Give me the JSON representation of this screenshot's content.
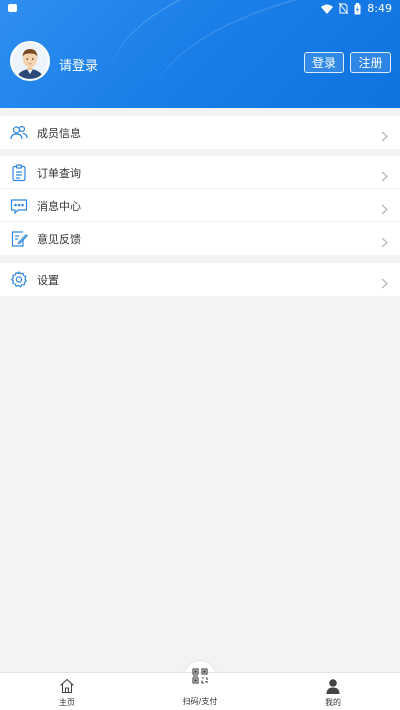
{
  "status_bar": {
    "time": "8:49",
    "icons": [
      "notification-icon",
      "wifi-icon",
      "no-sim-icon",
      "battery-icon"
    ]
  },
  "header": {
    "login_prompt": "请登录",
    "login_button": "登录",
    "register_button": "注册"
  },
  "menu": {
    "group1": [
      {
        "label": "成员信息",
        "icon": "members-icon"
      }
    ],
    "group2": [
      {
        "label": "订单查询",
        "icon": "order-icon"
      },
      {
        "label": "消息中心",
        "icon": "message-icon"
      },
      {
        "label": "意见反馈",
        "icon": "feedback-icon"
      }
    ],
    "group3": [
      {
        "label": "设置",
        "icon": "gear-icon"
      }
    ]
  },
  "tabbar": {
    "home": "主页",
    "scan_pay": "扫码/支付",
    "mine": "我的"
  },
  "colors": {
    "header_blue": "#1a7fe8",
    "icon_blue": "#2f86e0",
    "background": "#f3f3f3"
  }
}
